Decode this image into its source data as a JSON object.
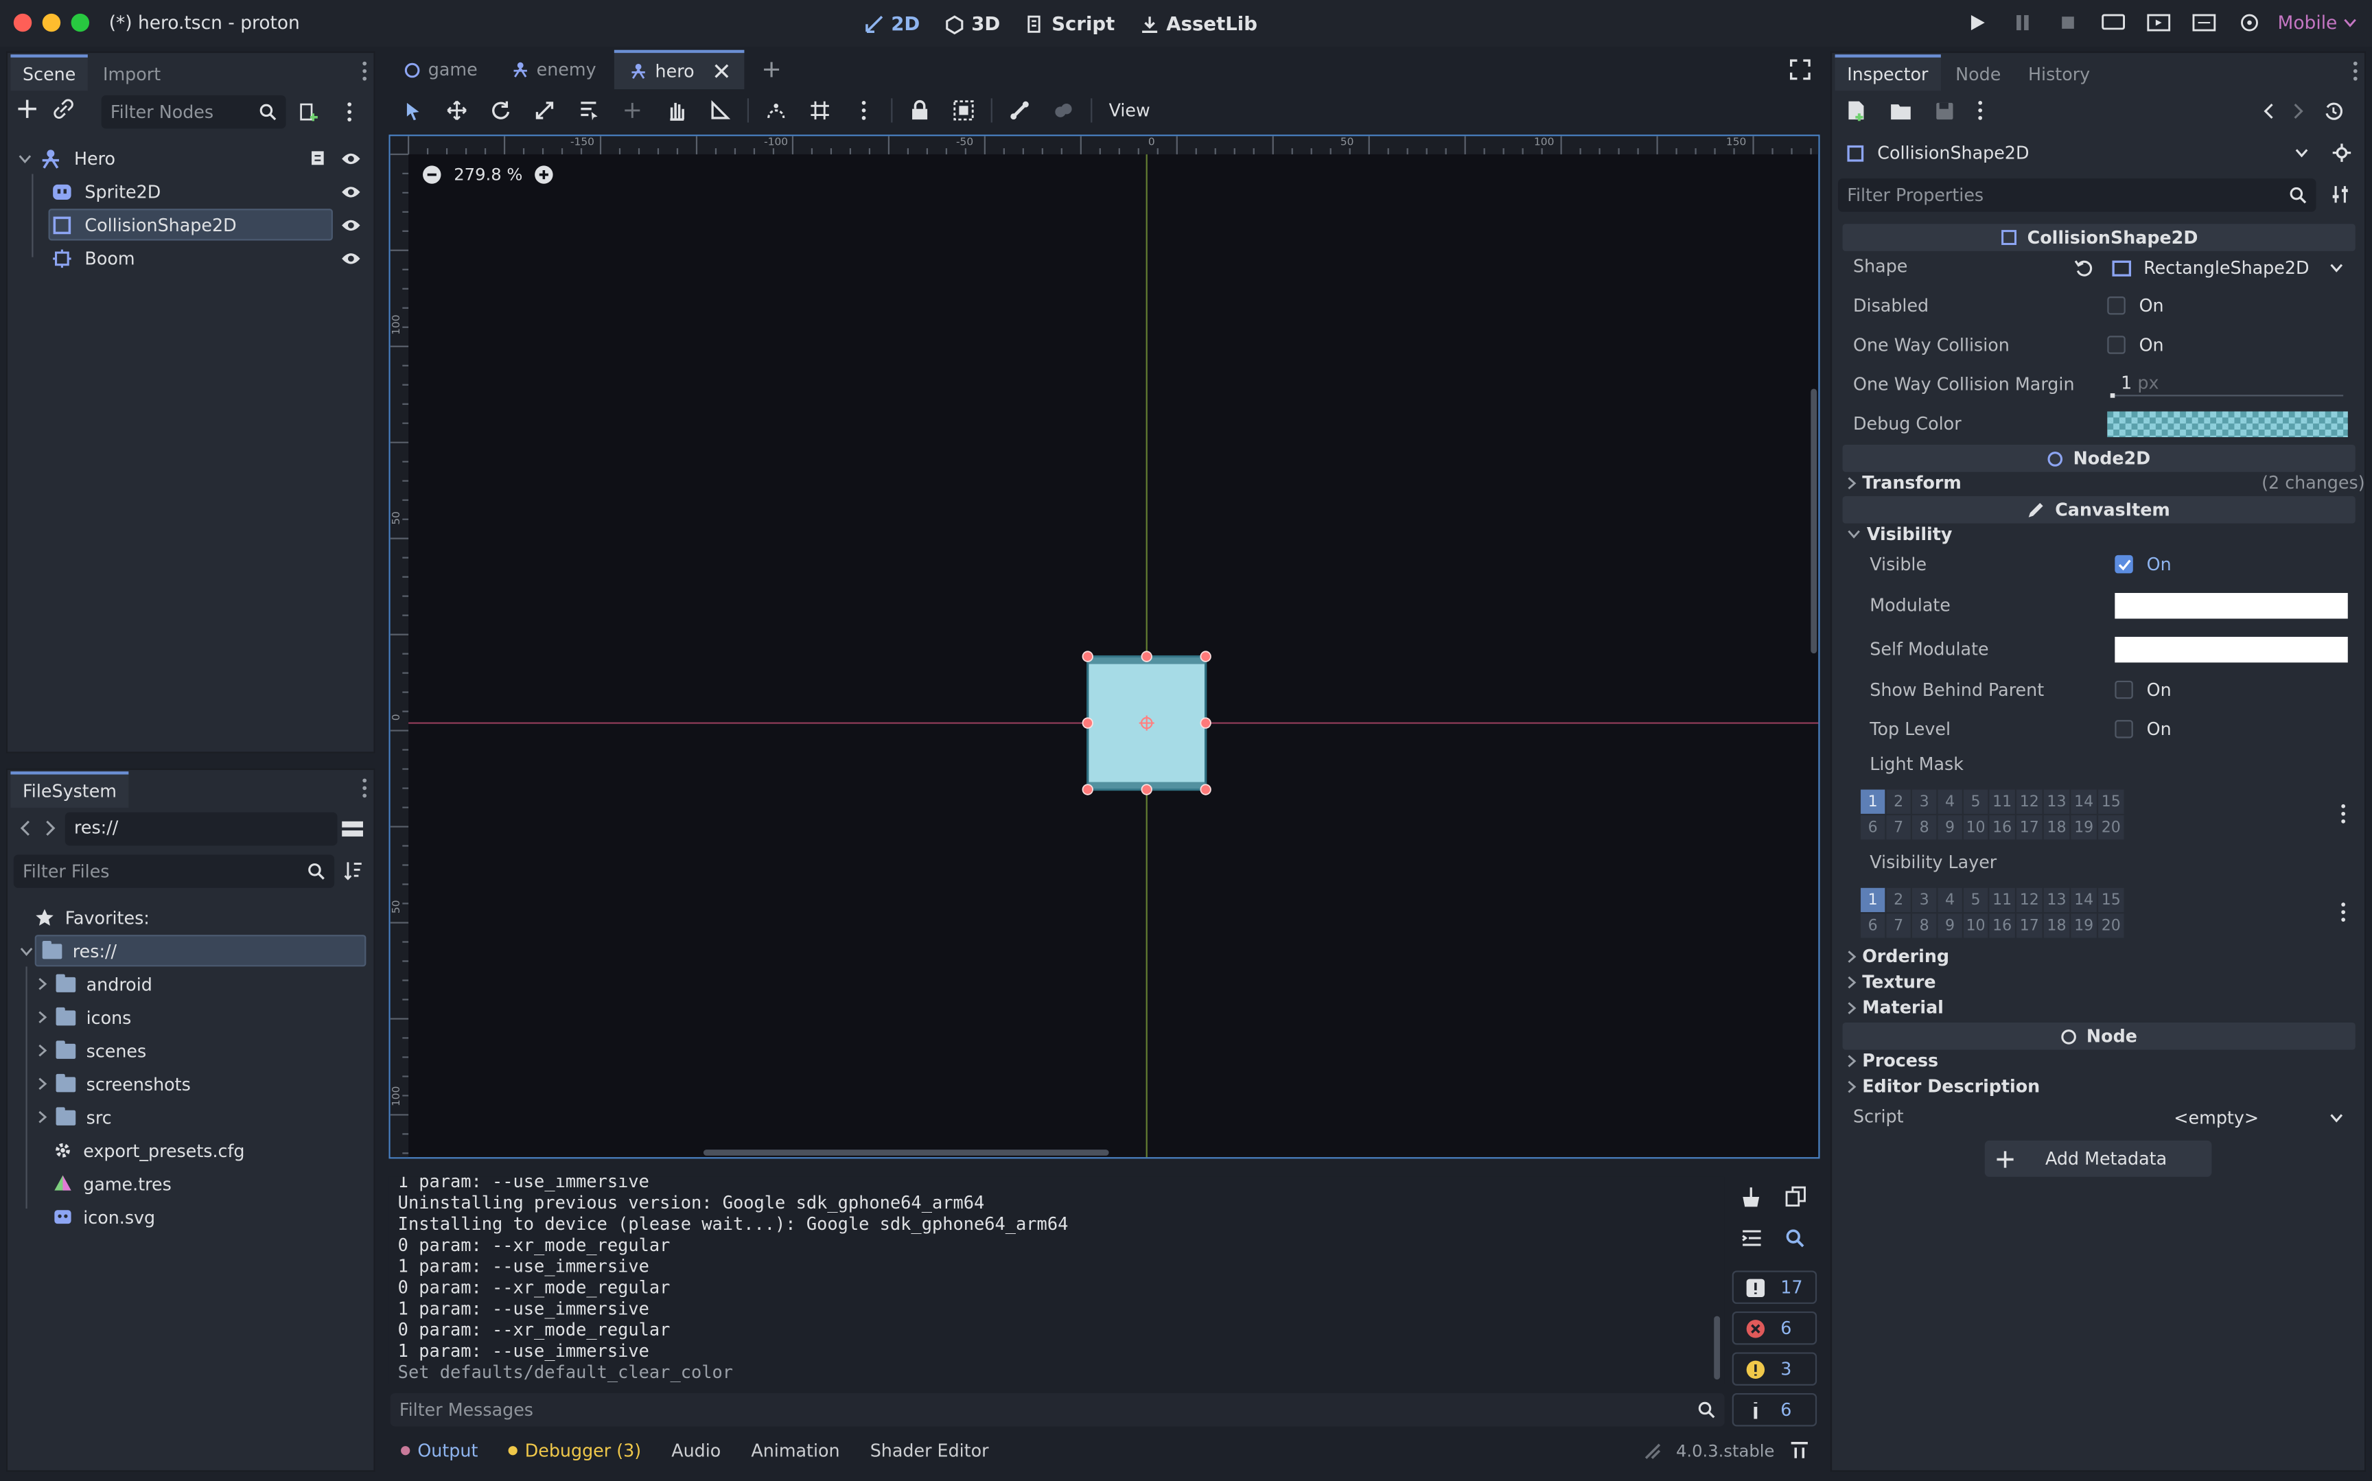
{
  "window": {
    "title": "(*) hero.tscn - proton"
  },
  "workspace_modes": [
    {
      "label": "2D",
      "icon": "2d-icon",
      "active": true
    },
    {
      "label": "3D",
      "icon": "3d-icon",
      "active": false
    },
    {
      "label": "Script",
      "icon": "script-icon",
      "active": false
    },
    {
      "label": "AssetLib",
      "icon": "assetlib-icon",
      "active": false
    }
  ],
  "renderer": "Mobile",
  "scene_dock": {
    "tabs": [
      "Scene",
      "Import"
    ],
    "filter_placeholder": "Filter Nodes",
    "nodes": [
      {
        "label": "Hero",
        "icon": "character-body-icon"
      },
      {
        "label": "Sprite2D",
        "icon": "sprite-icon"
      },
      {
        "label": "CollisionShape2D",
        "icon": "collision-shape-icon"
      },
      {
        "label": "Boom",
        "icon": "particles-icon"
      }
    ]
  },
  "filesystem_dock": {
    "tab": "FileSystem",
    "path": "res://",
    "filter_placeholder": "Filter Files",
    "favorites": "Favorites:",
    "root": "res://",
    "folders": [
      "android",
      "icons",
      "scenes",
      "screenshots",
      "src"
    ],
    "files": [
      {
        "label": "export_presets.cfg",
        "icon": "gear-icon"
      },
      {
        "label": "game.tres",
        "icon": "resource-icon"
      },
      {
        "label": "icon.svg",
        "icon": "image-icon"
      }
    ]
  },
  "editor_tabs": [
    {
      "label": "game",
      "active": false
    },
    {
      "label": "enemy",
      "active": false
    },
    {
      "label": "hero",
      "active": true
    }
  ],
  "toolbar": {
    "view_label": "View"
  },
  "viewport": {
    "zoom": "279.8 %",
    "ruler_top": [
      "-150",
      "-100",
      "-50",
      "0",
      "50",
      "100",
      "150"
    ],
    "ruler_left": [
      "100",
      "50",
      "0",
      "50",
      "100"
    ]
  },
  "console": {
    "lines": [
      "1 param: --use_immersive",
      "Uninstalling previous version: Google sdk_gphone64_arm64",
      "Installing to device (please wait...): Google sdk_gphone64_arm64",
      "0 param: --xr_mode_regular",
      "1 param: --use_immersive",
      "0 param: --xr_mode_regular",
      "1 param: --use_immersive",
      "0 param: --xr_mode_regular",
      "1 param: --use_immersive",
      "Set defaults/default_clear_color"
    ],
    "filter_placeholder": "Filter Messages",
    "counts": {
      "messages": "17",
      "errors": "6",
      "warnings": "3",
      "info": "6"
    }
  },
  "bottom_tabs": [
    "Output",
    "Debugger (3)",
    "Audio",
    "Animation",
    "Shader Editor"
  ],
  "version": "4.0.3.stable",
  "inspector": {
    "tabs": [
      "Inspector",
      "Node",
      "History"
    ],
    "object": "CollisionShape2D",
    "filter_placeholder": "Filter Properties",
    "section_collision": "CollisionShape2D",
    "shape_label": "Shape",
    "shape_value": "RectangleShape2D",
    "disabled_label": "Disabled",
    "one_way_label": "One Way Collision",
    "one_way_margin_label": "One Way Collision Margin",
    "one_way_margin_value": "1",
    "one_way_margin_unit": "px",
    "debug_color_label": "Debug Color",
    "on_text": "On",
    "section_node2d": "Node2D",
    "transform_label": "Transform",
    "transform_changes": "(2 changes)",
    "section_canvasitem": "CanvasItem",
    "visibility_label": "Visibility",
    "visible_label": "Visible",
    "modulate_label": "Modulate",
    "self_modulate_label": "Self Modulate",
    "show_behind_label": "Show Behind Parent",
    "top_level_label": "Top Level",
    "light_mask_label": "Light Mask",
    "visibility_layer_label": "Visibility Layer",
    "layer_row1": [
      "1",
      "2",
      "3",
      "4",
      "5",
      "11",
      "12",
      "13",
      "14",
      "15"
    ],
    "layer_row2": [
      "6",
      "7",
      "8",
      "9",
      "10",
      "16",
      "17",
      "18",
      "19",
      "20"
    ],
    "ordering_label": "Ordering",
    "texture_label": "Texture",
    "material_label": "Material",
    "section_node": "Node",
    "process_label": "Process",
    "editor_desc_label": "Editor Description",
    "script_label": "Script",
    "script_value": "<empty>",
    "add_metadata": "Add Metadata"
  },
  "colors": {
    "accent": "#6b8fd4",
    "collision_shape": "#a6dbe6",
    "handle": "#ff7a7a"
  }
}
